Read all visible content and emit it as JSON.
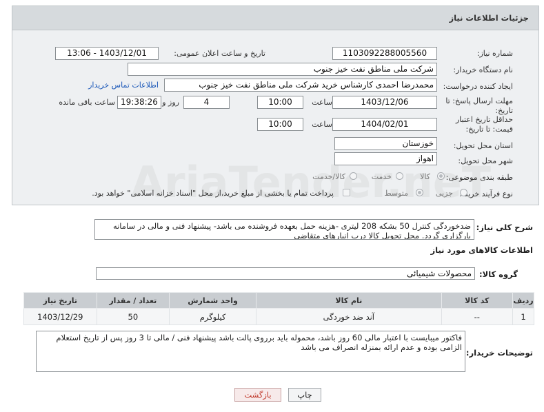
{
  "header": {
    "title": "جزئیات اطلاعات نیاز"
  },
  "fields": {
    "need_number": {
      "label": "شماره نیاز:",
      "value": "1103092288005560"
    },
    "announce_datetime": {
      "label": "تاریخ و ساعت اعلان عمومی:",
      "value": "1403/12/01 - 13:06"
    },
    "buyer_org": {
      "label": "نام دستگاه خریدار:",
      "value": "شرکت ملی مناطق نفت خیز جنوب"
    },
    "requester": {
      "label": "ایجاد کننده درخواست:",
      "value": "محمدرضا احمدی  کارشناس خرید  شرکت ملی مناطق نفت خیز جنوب",
      "link": "اطلاعات تماس خریدار"
    },
    "response_deadline": {
      "label": "مهلت ارسال پاسخ: تا تاریخ:",
      "date": "1403/12/06",
      "time_label": "ساعت",
      "time": "10:00",
      "days": "4",
      "days_label": "روز و",
      "remaining": "19:38:26",
      "remaining_label": "ساعت باقی مانده"
    },
    "price_validity": {
      "label": "حداقل تاریخ اعتبار قیمت: تا تاریخ:",
      "date": "1404/02/01",
      "time_label": "ساعت",
      "time": "10:00"
    },
    "province": {
      "label": "استان محل تحویل:",
      "value": "خوزستان"
    },
    "city": {
      "label": "شهر محل تحویل:",
      "value": "اهواز"
    },
    "category": {
      "label": "طبقه بندی موضوعی:",
      "options": [
        "کالا",
        "خدمت",
        "کالا/خدمت"
      ],
      "selected": "کالا"
    },
    "process_type": {
      "label": "نوع فرآیند خرید :",
      "options": [
        "جزیی",
        "متوسط"
      ],
      "selected": "متوسط",
      "payment_note": "پرداخت تمام یا بخشی از مبلغ خرید،از محل \"اسناد خزانه اسلامی\" خواهد بود."
    }
  },
  "summary": {
    "label": "شرح کلی نیاز:",
    "value": "ضدخوردگی کنترل 50 بشکه 208 لیتری -هزینه حمل بعهده فروشنده می باشد- پیشنهاد فنی و مالی در سامانه بارگزاری گردد. محل تحویل کالا درب انبارهای متقاضی"
  },
  "goods_info": {
    "title": "اطلاعات کالاهای مورد نیاز",
    "group_label": "گروه کالا:",
    "group_value": "محصولات شیمیائی"
  },
  "table": {
    "headers": [
      "ردیف",
      "کد کالا",
      "نام کالا",
      "واحد شمارش",
      "تعداد / مقدار",
      "تاریخ نیاز"
    ],
    "rows": [
      [
        "1",
        "--",
        "آند ضد خوردگی",
        "کیلوگرم",
        "50",
        "1403/12/29"
      ]
    ]
  },
  "buyer_notes": {
    "label": "توضیحات خریدار:",
    "value": "فاکتور میبایست با اعتبار مالی 60 روز باشد، محموله باید  برروی پالت باشد پیشنهاد فنی / مالی تا 3 روز پس از تاریخ استعلام الزامی بوده و عدم ارائه بمنزله انصراف می باشد"
  },
  "buttons": {
    "print": "چاپ",
    "back": "بازگشت"
  },
  "watermark": {
    "text": "AriaTender.neT"
  },
  "colors": {
    "header_bg": "#d6dadd",
    "link": "#1a57b8",
    "back_button": "#c0392b"
  }
}
